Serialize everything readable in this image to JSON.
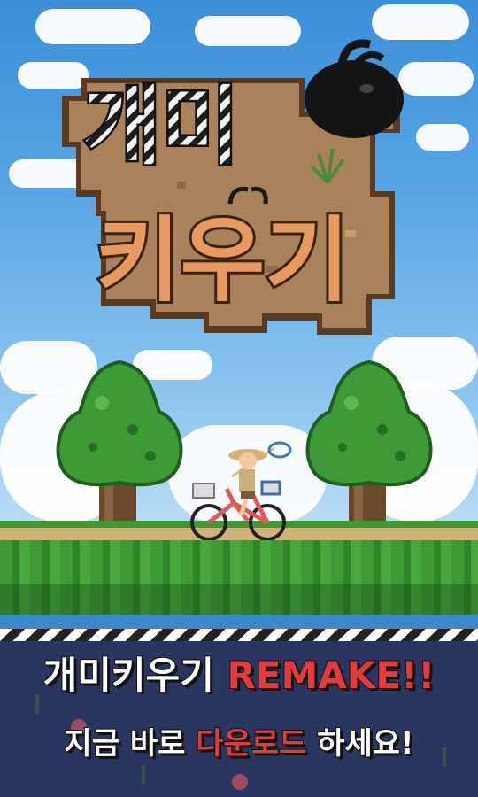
{
  "logo": {
    "line1": "개미",
    "line2": "키우기"
  },
  "banner": {
    "title_game": "개미키우기",
    "title_remake": "REMAKE!!",
    "sub_prefix": "지금 바로",
    "sub_highlight": "다운로드",
    "sub_suffix": "하세요!"
  },
  "colors": {
    "sky_top": "#3a8fd8",
    "sign_wood": "#a9815a",
    "sign_letters": "#e69a5f",
    "banner_bg": "#2a3560",
    "accent_red": "#e03c3c",
    "tree_green": "#3e9a36",
    "bicycle": "#e25a5a"
  },
  "icons": {
    "ant": "ant-icon",
    "grass_sprout": "sprout-icon"
  }
}
